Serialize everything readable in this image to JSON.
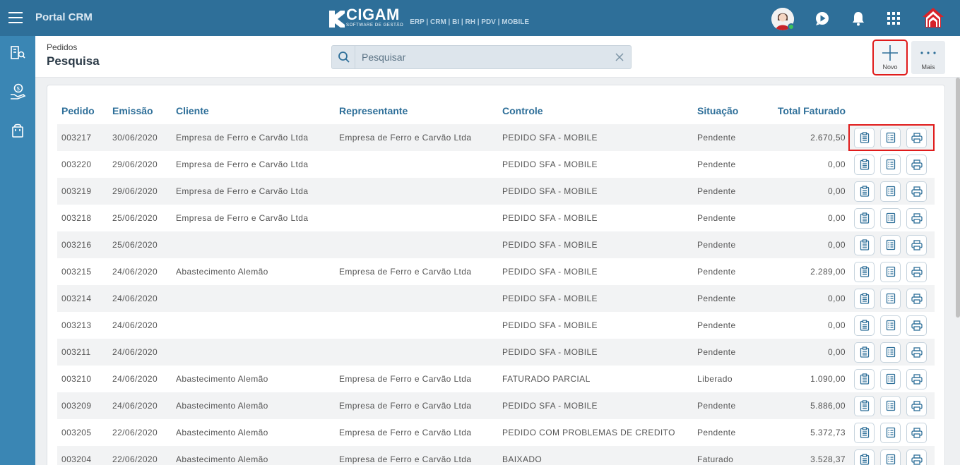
{
  "app": {
    "title": "Portal CRM"
  },
  "logo": {
    "name": "CIGAM",
    "tagline": "SOFTWARE DE GESTÃO",
    "modules": "ERP | CRM | BI | RH | PDV | MOBILE"
  },
  "header": {
    "breadcrumb": "Pedidos",
    "title": "Pesquisa",
    "search_placeholder": "Pesquisar",
    "novo_label": "Novo",
    "mais_label": "Mais"
  },
  "table": {
    "columns": {
      "pedido": "Pedido",
      "emissao": "Emissão",
      "cliente": "Cliente",
      "representante": "Representante",
      "controle": "Controle",
      "situacao": "Situação",
      "total": "Total Faturado"
    },
    "rows": [
      {
        "pedido": "003217",
        "emissao": "30/06/2020",
        "cliente": "Empresa de Ferro e Carvão Ltda",
        "representante": "Empresa de Ferro e Carvão Ltda",
        "controle": "PEDIDO SFA - MOBILE",
        "situacao": "Pendente",
        "total": "2.670,50"
      },
      {
        "pedido": "003220",
        "emissao": "29/06/2020",
        "cliente": "Empresa de Ferro e Carvão Ltda",
        "representante": "",
        "controle": "PEDIDO SFA - MOBILE",
        "situacao": "Pendente",
        "total": "0,00"
      },
      {
        "pedido": "003219",
        "emissao": "29/06/2020",
        "cliente": "Empresa de Ferro e Carvão Ltda",
        "representante": "",
        "controle": "PEDIDO SFA - MOBILE",
        "situacao": "Pendente",
        "total": "0,00"
      },
      {
        "pedido": "003218",
        "emissao": "25/06/2020",
        "cliente": "Empresa de Ferro e Carvão Ltda",
        "representante": "",
        "controle": "PEDIDO SFA - MOBILE",
        "situacao": "Pendente",
        "total": "0,00"
      },
      {
        "pedido": "003216",
        "emissao": "25/06/2020",
        "cliente": "",
        "representante": "",
        "controle": "PEDIDO SFA - MOBILE",
        "situacao": "Pendente",
        "total": "0,00"
      },
      {
        "pedido": "003215",
        "emissao": "24/06/2020",
        "cliente": "Abastecimento Alemão",
        "representante": "Empresa de Ferro e Carvão Ltda",
        "controle": "PEDIDO SFA - MOBILE",
        "situacao": "Pendente",
        "total": "2.289,00"
      },
      {
        "pedido": "003214",
        "emissao": "24/06/2020",
        "cliente": "",
        "representante": "",
        "controle": "PEDIDO SFA - MOBILE",
        "situacao": "Pendente",
        "total": "0,00"
      },
      {
        "pedido": "003213",
        "emissao": "24/06/2020",
        "cliente": "",
        "representante": "",
        "controle": "PEDIDO SFA - MOBILE",
        "situacao": "Pendente",
        "total": "0,00"
      },
      {
        "pedido": "003211",
        "emissao": "24/06/2020",
        "cliente": "",
        "representante": "",
        "controle": "PEDIDO SFA - MOBILE",
        "situacao": "Pendente",
        "total": "0,00"
      },
      {
        "pedido": "003210",
        "emissao": "24/06/2020",
        "cliente": "Abastecimento Alemão",
        "representante": "Empresa de Ferro e Carvão Ltda",
        "controle": "FATURADO PARCIAL",
        "situacao": "Liberado",
        "total": "1.090,00"
      },
      {
        "pedido": "003209",
        "emissao": "24/06/2020",
        "cliente": "Abastecimento Alemão",
        "representante": "Empresa de Ferro e Carvão Ltda",
        "controle": "PEDIDO SFA - MOBILE",
        "situacao": "Pendente",
        "total": "5.886,00"
      },
      {
        "pedido": "003205",
        "emissao": "22/06/2020",
        "cliente": "Abastecimento Alemão",
        "representante": "Empresa de Ferro e Carvão Ltda",
        "controle": "PEDIDO COM PROBLEMAS DE CREDITO",
        "situacao": "Pendente",
        "total": "5.372,73"
      },
      {
        "pedido": "003204",
        "emissao": "22/06/2020",
        "cliente": "Abastecimento Alemão",
        "representante": "Empresa de Ferro e Carvão Ltda",
        "controle": "BAIXADO",
        "situacao": "Faturado",
        "total": "3.528,37"
      }
    ],
    "row_actions": [
      "clipboard-icon",
      "checklist-icon",
      "printer-icon"
    ]
  },
  "sidebar": {
    "items": [
      "directory-icon",
      "finance-icon",
      "orders-bag-icon"
    ]
  },
  "topbar_icons": [
    "user-avatar",
    "play-circle-icon",
    "bell-icon",
    "apps-grid-icon",
    "home-icon"
  ],
  "colors": {
    "topbar": "#2e6f99",
    "sidebar": "#3a86b4",
    "header_text": "#2e6f99",
    "highlight": "#e01b1b"
  }
}
